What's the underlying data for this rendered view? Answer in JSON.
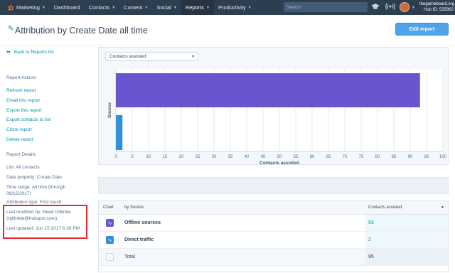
{
  "topnav": {
    "items": [
      {
        "label": "Marketing",
        "caret": "▼"
      },
      {
        "label": "Dashboard",
        "caret": ""
      },
      {
        "label": "Contacts",
        "caret": "▼"
      },
      {
        "label": "Content",
        "caret": "▼"
      },
      {
        "label": "Social",
        "caret": "▼"
      },
      {
        "label": "Reports",
        "caret": "▼"
      },
      {
        "label": "Productivity",
        "caret": "▼"
      }
    ],
    "active_index": 5,
    "search_placeholder": "Search",
    "account_name": "thegameboard.org",
    "hub_id": "Hub ID: 525862",
    "logo_color": "#f57722"
  },
  "header": {
    "title": "Attribution by Create Date all time",
    "edit_button": "Edit report"
  },
  "sidebar": {
    "back_link": "Back to Reports list",
    "actions_title": "Report Actions",
    "actions": [
      "Refresh report",
      "Email this report",
      "Export this report",
      "Export contacts to list",
      "Clone report",
      "Delete report"
    ],
    "details_title": "Report Details",
    "details": [
      "List: All contacts",
      "Date property: Create Date",
      "Time range: All time (through 06/15/2017)",
      "Attribution type: First touch",
      "Last modified by: Reed Gilbride (rgilbride@hubspot.com)",
      "Last updated: Jun 15 2017 6:39 PM"
    ]
  },
  "chart_controls": {
    "metric_select": "Contacts assisted"
  },
  "chart_data": {
    "type": "bar",
    "orientation": "horizontal",
    "categories": [
      "Offline sources",
      "Direct traffic"
    ],
    "values": [
      93,
      2
    ],
    "colors": [
      "#6a55d0",
      "#2f8fd8"
    ],
    "xlabel": "Contacts assisted",
    "ylabel": "Source",
    "xlim": [
      0,
      100
    ],
    "xticks": [
      0,
      5,
      10,
      15,
      20,
      25,
      30,
      35,
      40,
      45,
      50,
      55,
      60,
      65,
      70,
      75,
      80,
      85,
      90,
      95,
      100
    ],
    "grid": true
  },
  "table": {
    "headers": {
      "chart": "Chart",
      "source": "by Source",
      "metric": "Contacts assisted"
    },
    "rows": [
      {
        "label": "Offline sources",
        "value": "93",
        "icon_color": "#6a55d0"
      },
      {
        "label": "Direct traffic",
        "value": "2",
        "icon_color": "#2f8fd8"
      }
    ],
    "total": {
      "label": "Total",
      "value": "95"
    }
  }
}
